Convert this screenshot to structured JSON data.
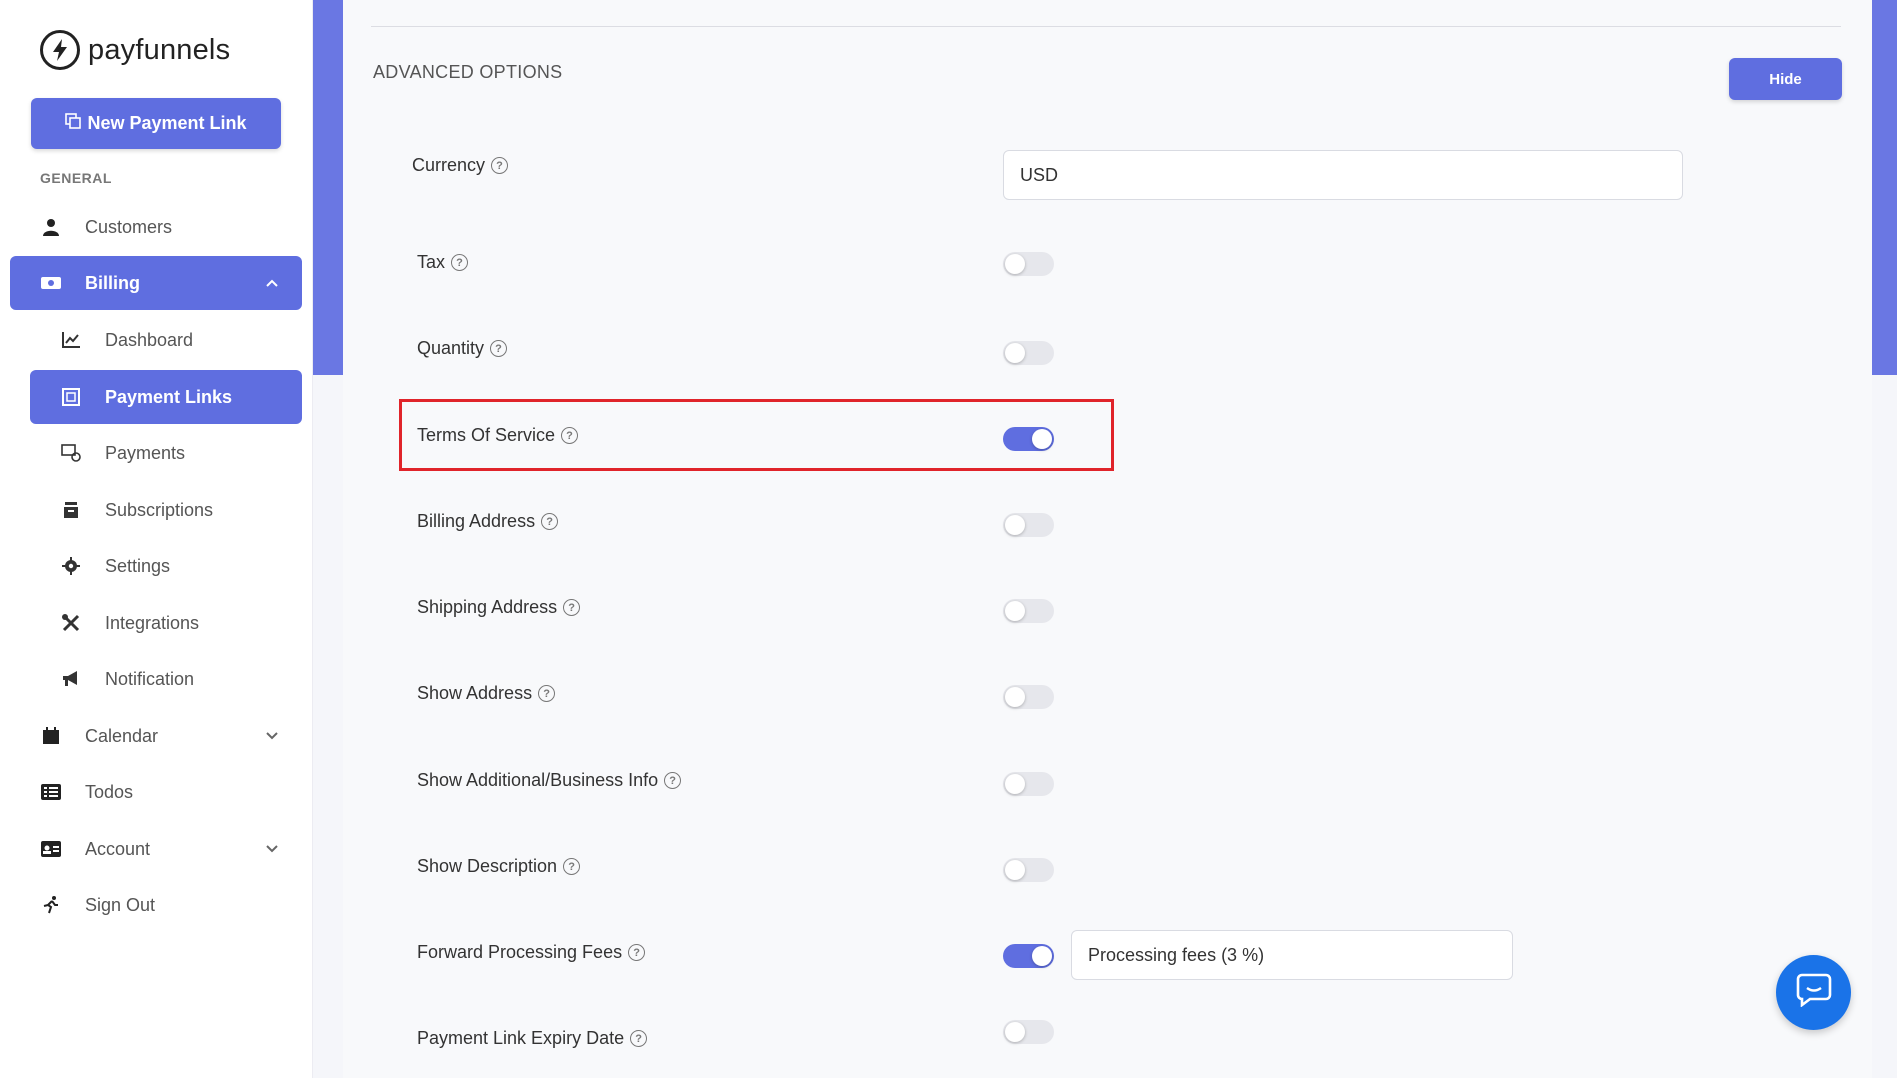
{
  "brand": {
    "name": "payfunnels"
  },
  "sidebar": {
    "new_link_label": "New Payment Link",
    "section_label": "GENERAL",
    "items": {
      "customers": "Customers",
      "billing": "Billing",
      "dashboard": "Dashboard",
      "payment_links": "Payment Links",
      "payments": "Payments",
      "subscriptions": "Subscriptions",
      "settings": "Settings",
      "integrations": "Integrations",
      "notification": "Notification",
      "calendar": "Calendar",
      "todos": "Todos",
      "account": "Account",
      "sign_out": "Sign Out"
    }
  },
  "main": {
    "section_title": "ADVANCED OPTIONS",
    "hide_label": "Hide",
    "currency": {
      "label": "Currency",
      "value": "USD"
    },
    "options": {
      "tax": {
        "label": "Tax",
        "enabled": false
      },
      "quantity": {
        "label": "Quantity",
        "enabled": false
      },
      "terms_of_service": {
        "label": "Terms Of Service",
        "enabled": true
      },
      "billing_address": {
        "label": "Billing Address",
        "enabled": false
      },
      "shipping_address": {
        "label": "Shipping Address",
        "enabled": false
      },
      "show_address": {
        "label": "Show Address",
        "enabled": false
      },
      "show_additional_info": {
        "label": "Show Additional/Business Info",
        "enabled": false
      },
      "show_description": {
        "label": "Show Description",
        "enabled": false
      },
      "forward_processing_fees": {
        "label": "Forward Processing Fees",
        "enabled": true,
        "field_value": "Processing fees (3 %)"
      },
      "payment_link_expiry_date": {
        "label": "Payment Link Expiry Date",
        "enabled": false
      }
    }
  },
  "colors": {
    "accent": "#5f6ee0",
    "highlight": "#e0242a",
    "chat": "#1a73e8"
  }
}
